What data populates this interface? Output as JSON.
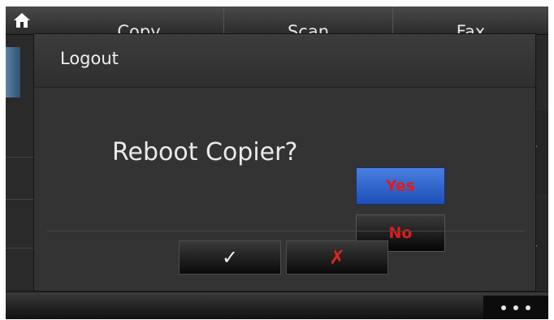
{
  "topbar": {
    "home_icon": "home-icon",
    "tabs": [
      {
        "label": "Copy"
      },
      {
        "label": "Scan"
      },
      {
        "label": "Fax"
      }
    ]
  },
  "dialog": {
    "title": "Logout",
    "question": "Reboot Copier?",
    "yes_label": "Yes",
    "no_label": "No",
    "confirm_icon": "checkmark-icon",
    "cancel_icon": "x-icon"
  },
  "right_scroll": {
    "up_icon": "chevron-up-icon",
    "down_icon": "chevron-down-icon"
  },
  "bottombar": {
    "more_icon": "more-dots-icon"
  },
  "colors": {
    "selected_option": "#2f62cf",
    "option_text": "#e01b1b",
    "cancel_mark": "#e0241b"
  }
}
